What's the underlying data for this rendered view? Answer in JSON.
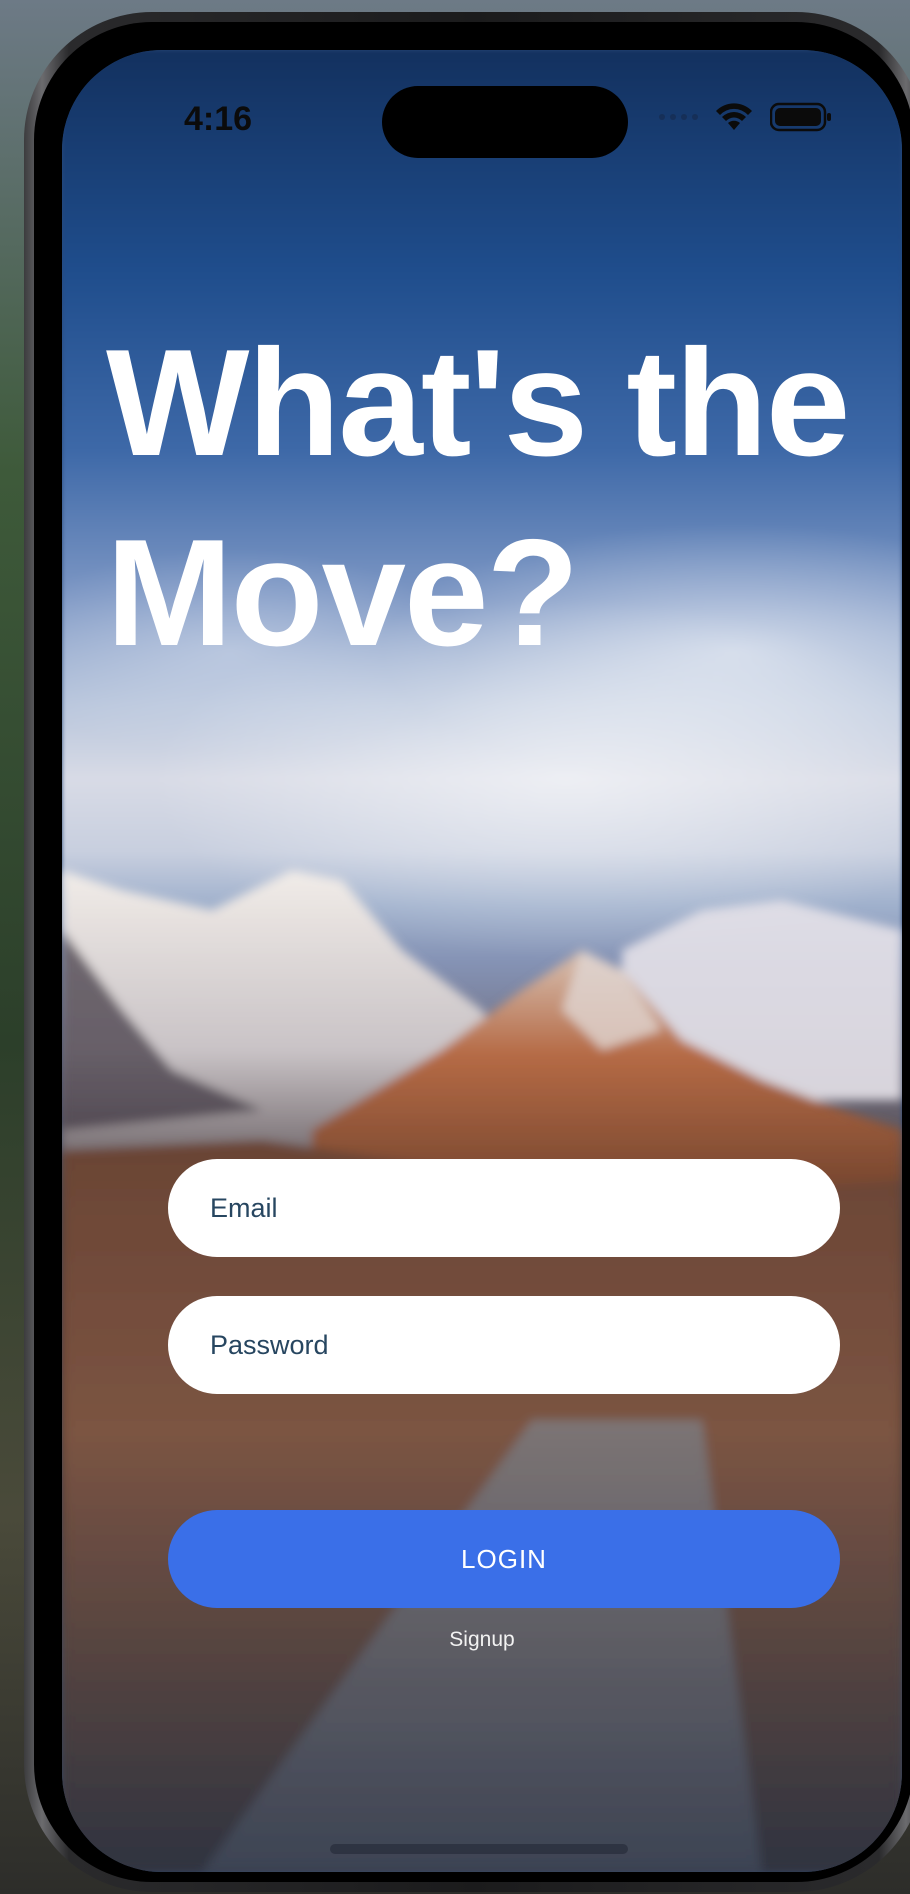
{
  "status_bar": {
    "time": "4:16",
    "wifi_icon": "wifi-icon",
    "battery_icon": "battery-icon"
  },
  "headline": "What's the Move?",
  "form": {
    "email_placeholder": "Email",
    "email_value": "",
    "password_placeholder": "Password",
    "password_value": "",
    "login_label": "LOGIN",
    "signup_label": "Signup"
  },
  "colors": {
    "accent": "#3a6fe8",
    "field_background": "#ffffff",
    "headline": "#ffffff"
  }
}
